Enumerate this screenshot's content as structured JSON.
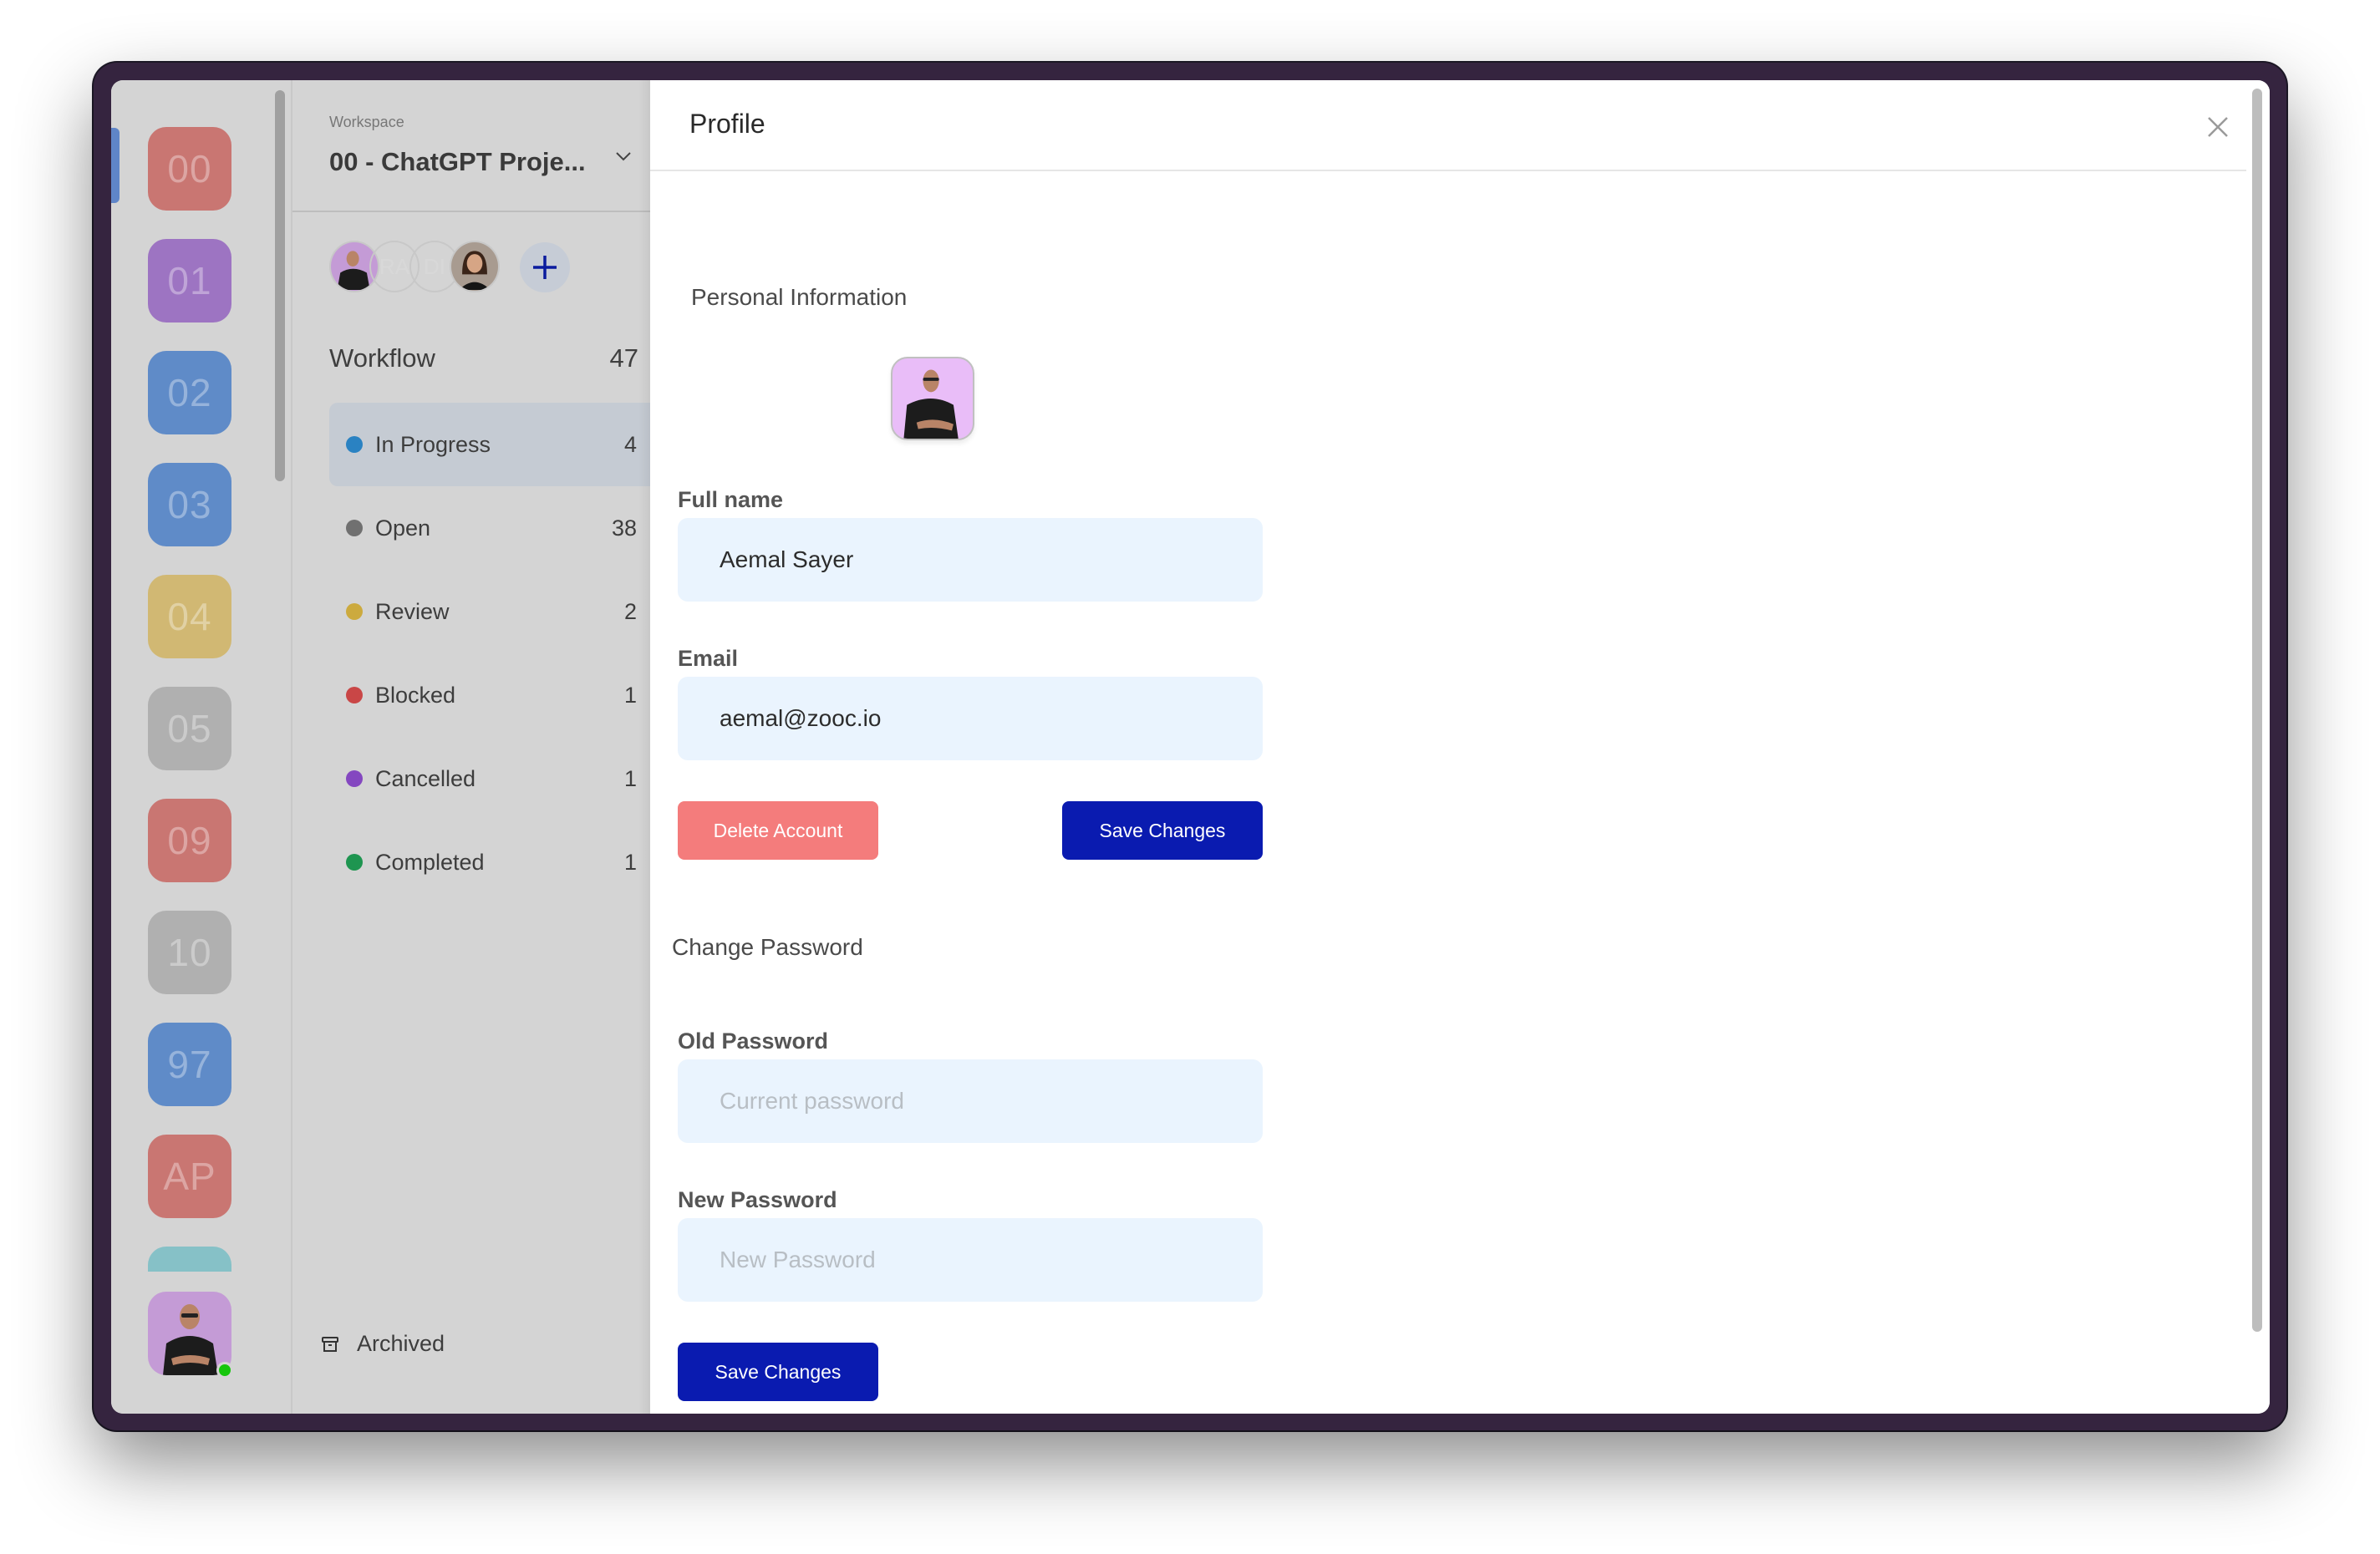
{
  "rail": {
    "workspaces": [
      {
        "label": "00",
        "color": "#c97672",
        "selected": true
      },
      {
        "label": "01",
        "color": "#9d74c2",
        "selected": false
      },
      {
        "label": "02",
        "color": "#5f8bc8",
        "selected": false
      },
      {
        "label": "03",
        "color": "#5f8bc8",
        "selected": false
      },
      {
        "label": "04",
        "color": "#d1b873",
        "selected": false
      },
      {
        "label": "05",
        "color": "#b0b0b0",
        "selected": false
      },
      {
        "label": "09",
        "color": "#c97672",
        "selected": false
      },
      {
        "label": "10",
        "color": "#b0b0b0",
        "selected": false
      },
      {
        "label": "97",
        "color": "#5f8bc8",
        "selected": false
      },
      {
        "label": "AP",
        "color": "#c97672",
        "selected": false
      }
    ],
    "partial_tile_color": "#86c1c7",
    "user_status": "online"
  },
  "workspace": {
    "label": "Workspace",
    "name": "00 - ChatGPT Proje...",
    "members": [
      {
        "initials": "",
        "type": "photo",
        "bg": "#c49bd6"
      },
      {
        "initials": "RA",
        "type": "initials",
        "bg": "#b0b0b0"
      },
      {
        "initials": "DI",
        "type": "initials",
        "bg": "#b0b0b0"
      },
      {
        "initials": "",
        "type": "photo",
        "bg": "#9c8f86"
      }
    ],
    "workflow": {
      "title": "Workflow",
      "total": "47",
      "items": [
        {
          "label": "In Progress",
          "count": "4",
          "color": "#2a82c2",
          "active": true
        },
        {
          "label": "Open",
          "count": "38",
          "color": "#707070",
          "active": false
        },
        {
          "label": "Review",
          "count": "2",
          "color": "#ccaa3e",
          "active": false
        },
        {
          "label": "Blocked",
          "count": "1",
          "color": "#c94646",
          "active": false
        },
        {
          "label": "Cancelled",
          "count": "1",
          "color": "#8447c0",
          "active": false
        },
        {
          "label": "Completed",
          "count": "1",
          "color": "#1e9550",
          "active": false
        }
      ]
    },
    "archived_label": "Archived"
  },
  "profile": {
    "title": "Profile",
    "personal_section": "Personal Information",
    "full_name_label": "Full name",
    "full_name_value": "Aemal Sayer",
    "email_label": "Email",
    "email_value": "aemal@zooc.io",
    "delete_label": "Delete Account",
    "save_label": "Save Changes",
    "password_section": "Change Password",
    "old_password_label": "Old Password",
    "old_password_placeholder": "Current password",
    "new_password_label": "New Password",
    "new_password_placeholder": "New Password",
    "save_password_label": "Save Changes"
  },
  "colors": {
    "primary": "#0a1bb0",
    "danger": "#f47c7c",
    "input_bg": "#eaf4fe",
    "bezel": "#35243f"
  }
}
